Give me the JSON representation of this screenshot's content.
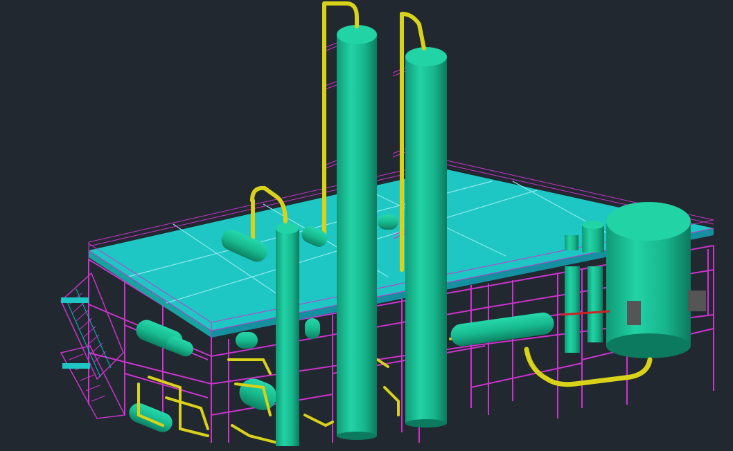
{
  "viewport": {
    "background": "#212830",
    "colors": {
      "structure": "#cc33cc",
      "deck": "#1fc7c4",
      "deck_grid": "#8fe9ef",
      "vessel": "#19c79a",
      "vessel_shade": "#0e8f6e",
      "pipe": "#d9d21a",
      "pipe_dark": "#9e9a10",
      "accent_red": "#cc2222",
      "ladder": "#00c0c0"
    }
  }
}
